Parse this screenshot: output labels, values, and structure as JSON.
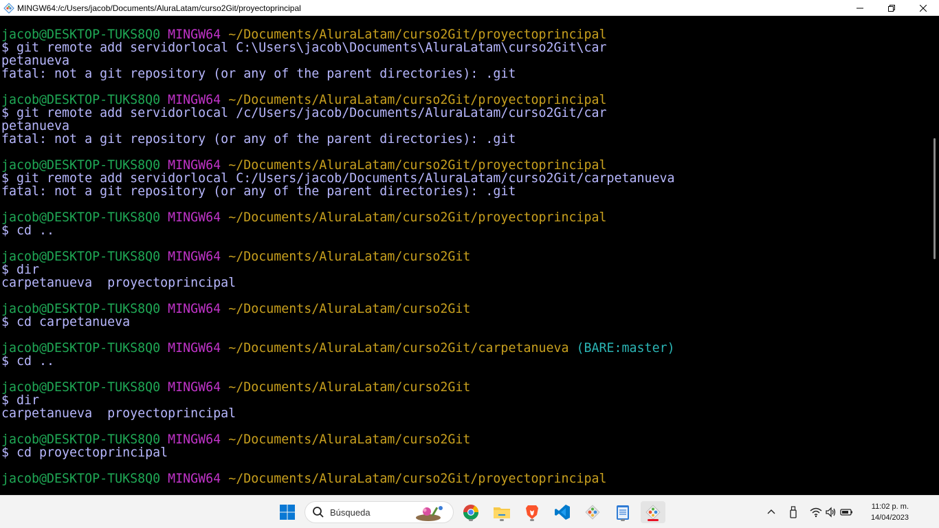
{
  "window": {
    "title": "MINGW64:/c/Users/jacob/Documents/AluraLatam/curso2Git/proyectoprincipal"
  },
  "terminal": {
    "lines": [
      {
        "type": "prompt",
        "user": "jacob@DESKTOP-TUKS8Q0",
        "env": "MINGW64",
        "path": "~/Documents/AluraLatam/curso2Git/proyectoprincipal",
        "branch": ""
      },
      {
        "type": "cmd",
        "text": "$ git remote add servidorlocal C:\\Users\\jacob\\Documents\\AluraLatam\\curso2Git\\car"
      },
      {
        "type": "out",
        "text": "petanueva"
      },
      {
        "type": "out",
        "text": "fatal: not a git repository (or any of the parent directories): .git"
      },
      {
        "type": "blank",
        "text": ""
      },
      {
        "type": "prompt",
        "user": "jacob@DESKTOP-TUKS8Q0",
        "env": "MINGW64",
        "path": "~/Documents/AluraLatam/curso2Git/proyectoprincipal",
        "branch": ""
      },
      {
        "type": "cmd",
        "text": "$ git remote add servidorlocal /c/Users/jacob/Documents/AluraLatam/curso2Git/car"
      },
      {
        "type": "out",
        "text": "petanueva"
      },
      {
        "type": "out",
        "text": "fatal: not a git repository (or any of the parent directories): .git"
      },
      {
        "type": "blank",
        "text": ""
      },
      {
        "type": "prompt",
        "user": "jacob@DESKTOP-TUKS8Q0",
        "env": "MINGW64",
        "path": "~/Documents/AluraLatam/curso2Git/proyectoprincipal",
        "branch": ""
      },
      {
        "type": "cmd",
        "text": "$ git remote add servidorlocal C:/Users/jacob/Documents/AluraLatam/curso2Git/carpetanueva"
      },
      {
        "type": "out",
        "text": "fatal: not a git repository (or any of the parent directories): .git"
      },
      {
        "type": "blank",
        "text": ""
      },
      {
        "type": "prompt",
        "user": "jacob@DESKTOP-TUKS8Q0",
        "env": "MINGW64",
        "path": "~/Documents/AluraLatam/curso2Git/proyectoprincipal",
        "branch": ""
      },
      {
        "type": "cmd",
        "text": "$ cd .."
      },
      {
        "type": "blank",
        "text": ""
      },
      {
        "type": "prompt",
        "user": "jacob@DESKTOP-TUKS8Q0",
        "env": "MINGW64",
        "path": "~/Documents/AluraLatam/curso2Git",
        "branch": ""
      },
      {
        "type": "cmd",
        "text": "$ dir"
      },
      {
        "type": "out",
        "text": "carpetanueva  proyectoprincipal"
      },
      {
        "type": "blank",
        "text": ""
      },
      {
        "type": "prompt",
        "user": "jacob@DESKTOP-TUKS8Q0",
        "env": "MINGW64",
        "path": "~/Documents/AluraLatam/curso2Git",
        "branch": ""
      },
      {
        "type": "cmd",
        "text": "$ cd carpetanueva"
      },
      {
        "type": "blank",
        "text": ""
      },
      {
        "type": "prompt",
        "user": "jacob@DESKTOP-TUKS8Q0",
        "env": "MINGW64",
        "path": "~/Documents/AluraLatam/curso2Git/carpetanueva",
        "branch": "(BARE:master)"
      },
      {
        "type": "cmd",
        "text": "$ cd .."
      },
      {
        "type": "blank",
        "text": ""
      },
      {
        "type": "prompt",
        "user": "jacob@DESKTOP-TUKS8Q0",
        "env": "MINGW64",
        "path": "~/Documents/AluraLatam/curso2Git",
        "branch": ""
      },
      {
        "type": "cmd",
        "text": "$ dir"
      },
      {
        "type": "out",
        "text": "carpetanueva  proyectoprincipal"
      },
      {
        "type": "blank",
        "text": ""
      },
      {
        "type": "prompt",
        "user": "jacob@DESKTOP-TUKS8Q0",
        "env": "MINGW64",
        "path": "~/Documents/AluraLatam/curso2Git",
        "branch": ""
      },
      {
        "type": "cmd",
        "text": "$ cd proyectoprincipal"
      },
      {
        "type": "blank",
        "text": ""
      },
      {
        "type": "prompt",
        "user": "jacob@DESKTOP-TUKS8Q0",
        "env": "MINGW64",
        "path": "~/Documents/AluraLatam/curso2Git/proyectoprincipal",
        "branch": ""
      }
    ]
  },
  "taskbar": {
    "search_placeholder": "Búsqueda",
    "apps": [
      {
        "name": "windows-start",
        "icon": "windows-logo-icon"
      },
      {
        "name": "chrome",
        "icon": "chrome-icon"
      },
      {
        "name": "file-explorer",
        "icon": "folder-icon"
      },
      {
        "name": "brave",
        "icon": "brave-icon"
      },
      {
        "name": "vscode",
        "icon": "vscode-icon"
      },
      {
        "name": "git-gui",
        "icon": "git-icon"
      },
      {
        "name": "notepad",
        "icon": "notepad-icon"
      },
      {
        "name": "git-bash",
        "icon": "git-bash-icon"
      }
    ],
    "clock": {
      "time": "11:02 p. m.",
      "date": "14/04/2023"
    }
  },
  "colors": {
    "user": "#1fa855",
    "env": "#c033c8",
    "path": "#c8a01e",
    "branch": "#2bb5b5",
    "text": "#b8b8ff"
  }
}
